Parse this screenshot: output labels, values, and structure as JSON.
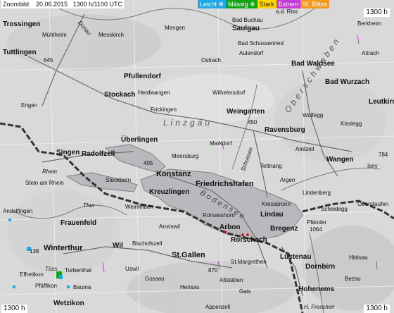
{
  "header": {
    "product": "Zoombild",
    "date": "20.06.2015",
    "time": "1300 h/1100 UTC"
  },
  "legend": [
    {
      "label": "Leicht",
      "color": "#1fa8e8",
      "text": "#ffffff",
      "icon": "snowflake-icon"
    },
    {
      "label": "Mässig",
      "color": "#0fa60f",
      "text": "#ffffff",
      "icon": "snowflake-icon"
    },
    {
      "label": "Stark",
      "color": "#ffd400",
      "text": "#222222",
      "icon": ""
    },
    {
      "label": "Extrem",
      "color": "#c43ad8",
      "text": "#ffffff",
      "icon": ""
    },
    {
      "label": "W. Blitze",
      "color": "#f39a1e",
      "text": "#ffffff",
      "icon": ""
    }
  ],
  "corners": {
    "top_right": "1300 h",
    "bottom_left": "1300 h",
    "bottom_right": "1300 h",
    "credit": "H. Freschen"
  },
  "places": {
    "trossingen": "Trossingen",
    "muhlheim": "Mühlheim",
    "tuttlingen": "Tuttlingen",
    "messkirch": "Messkirch",
    "mengen": "Mengen",
    "saulgau": "Saulgau",
    "bad_buchau": "Bad Buchau",
    "bad_schussenried": "Bad Schussenried",
    "aulendorf": "Aulendorf",
    "bad_waldsee": "Bad Waldsee",
    "bad_wurzach": "Bad Wurzach",
    "pfullendorf": "Pfullendorf",
    "ostrach": "Ostrach",
    "stockach": "Stockach",
    "herdwangen": "Herdwangen",
    "wilhelmsdorf": "Wilhelmsdorf",
    "engen": "Engen",
    "frickingen": "Frickingen",
    "weingarten": "Weingarten",
    "ravensburg": "Ravensburg",
    "wolfegg": "Wolfegg",
    "kisslegg": "Kisslegg",
    "leutkirch": "Leutkirch",
    "uberlingen": "Überlingen",
    "singen": "Singen",
    "radolfzell": "Radolfzell",
    "meersburg": "Meersburg",
    "markdorf": "Markdorf",
    "amtzell": "Amtzell",
    "wangen": "Wangen",
    "isny": "Isny",
    "konstanz": "Konstanz",
    "friedrichshafen": "Friedrichshafen",
    "tettnang": "Tettnang",
    "kreuzlingen": "Kreuzlingen",
    "stein_am_rhein": "Stein am Rhein",
    "steckborn": "Steckborn",
    "lindenberg": "Lindenberg",
    "kressbronn": "Kressbronn",
    "lindau": "Lindau",
    "scheidegg": "Scheidegg",
    "oberstaufen": "Oberstaufen",
    "andelfingen": "Andelfingen",
    "frauenfeld": "Frauenfeld",
    "weinfelden": "Weinfelden",
    "romanshorn": "Romanshorn",
    "arbon": "Arbon",
    "rorschach": "Rorschach",
    "bregenz": "Bregenz",
    "pfander": "Pfänder",
    "pfander_alt": "1064",
    "amriswil": "Amriswil",
    "winterthur": "Winterthur",
    "wil": "Wil",
    "bischofszell": "Bischofszell",
    "st_gallen": "St.Gallen",
    "st_margrethen": "St.Margrethen",
    "lustenau": "Lustenau",
    "dornbirn": "Dornbirn",
    "hittisau": "Hittisau",
    "effretikon": "Effretikon",
    "turbenthal": "Turbenthal",
    "pfaffikon": "Pfäffikon",
    "bauma": "Bauma",
    "uzwil": "Uzwil",
    "gossau": "Gossau",
    "herisau": "Herisau",
    "altstatten": "Altstätten",
    "hohenems": "Hohenems",
    "wetzikon": "Wetzikon",
    "appenzell": "Appenzell",
    "bezau": "Bezau",
    "gais": "Gais",
    "a_d_riss": "a.d. Riss",
    "berkheim": "Berkheim",
    "aitrach": "Aitrach",
    "linzgau": "Linzgau",
    "oberschwaben": "Oberschwaben",
    "bodensee": "Bodensee",
    "schussen": "Schussen",
    "argen": "Argen",
    "thur": "Thur",
    "toss": "Töss",
    "donau": "Donau",
    "rhein": "Rhein",
    "route_645": "645",
    "route_405": "405",
    "route_450": "450",
    "route_784": "784",
    "route_870": "870",
    "route_138": "138"
  },
  "colors": {
    "land": "#dcdcdc",
    "lake": "#b9b9bd",
    "road": "#8a8a8a",
    "border": "#3a3a3a",
    "grid": "#f2f2f2"
  }
}
